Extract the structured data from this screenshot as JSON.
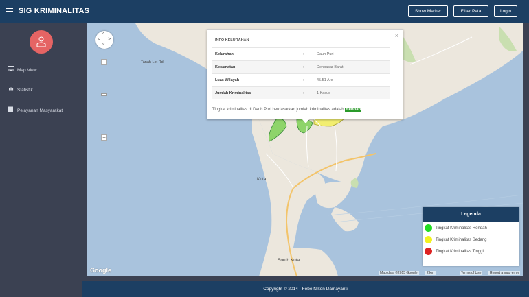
{
  "header": {
    "title": "SIG KRIMINALITAS",
    "buttons": [
      "Show Marker",
      "Filter Peta",
      "Login"
    ]
  },
  "sidebar": {
    "items": [
      {
        "label": "Map View",
        "icon": "monitor-icon"
      },
      {
        "label": "Statistik",
        "icon": "bar-chart-icon"
      },
      {
        "label": "Pelayanan Masyarakat",
        "icon": "book-icon"
      }
    ]
  },
  "map": {
    "labels": {
      "tanah_lot": "Tanah Lot Rd",
      "kuta": "Kuta",
      "south_kuta": "South Kuta"
    },
    "zoom_plus": "+",
    "zoom_minus": "−",
    "google": "Google",
    "attribution": {
      "data": "Map data ©2015 Google",
      "scale": "2 km",
      "terms": "Terms of Use",
      "report": "Report a map error"
    }
  },
  "info": {
    "heading": "INFO KELURAHAN",
    "close": "×",
    "rows": [
      {
        "key": "Kelurahan",
        "value": "Dauh Puri"
      },
      {
        "key": "Kecamatan",
        "value": "Denpasar Barat"
      },
      {
        "key": "Luas Wilayah",
        "value": "45.51 Are"
      },
      {
        "key": "Jumlah Kriminalitas",
        "value": "1 Kasus"
      }
    ],
    "separator": ":",
    "text": "Tingkat kriminalitas di Dauh Puri berdasarkan jumlah kriminalitas adalah",
    "level": "Rendah"
  },
  "legend": {
    "title": "Legenda",
    "items": [
      {
        "label": "Tingkat Kriminalitas Rendah",
        "color": "#22dd22"
      },
      {
        "label": "Tingkat Kriminalitas Sedang",
        "color": "#f2f220"
      },
      {
        "label": "Tingkat Kriminalitas Tinggi",
        "color": "#dd2222"
      }
    ]
  },
  "footer": {
    "text": "Copyright © 2014 - Febe Nikon Damayanti"
  }
}
